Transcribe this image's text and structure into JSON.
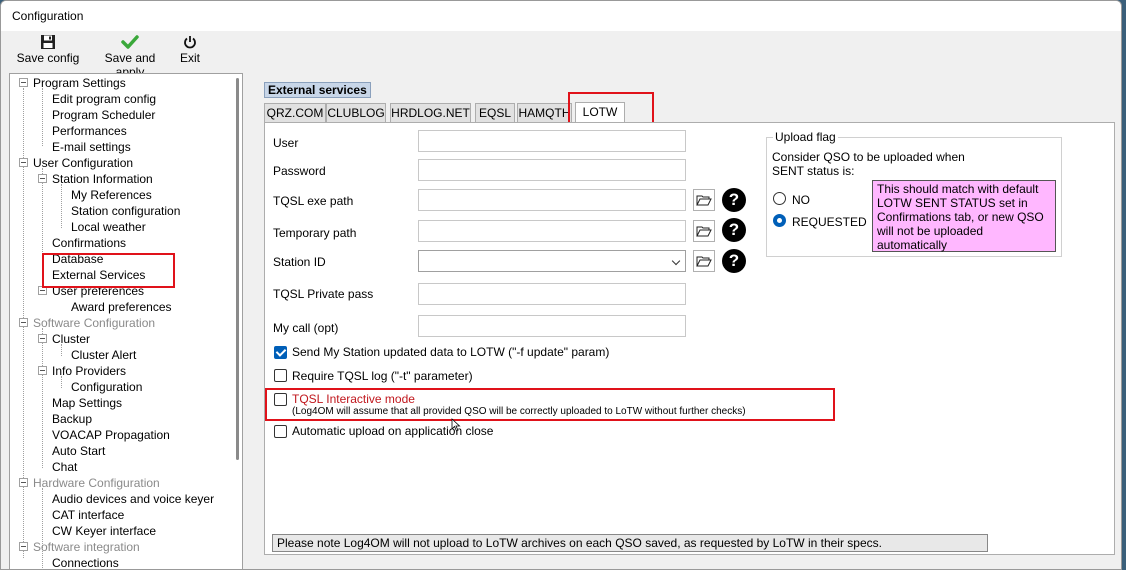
{
  "window": {
    "title": "Configuration"
  },
  "toolbar": {
    "save_config": "Save config",
    "save_apply": "Save and apply",
    "exit": "Exit"
  },
  "tree": {
    "program_settings": "Program Settings",
    "edit_program_config": "Edit program config",
    "program_scheduler": "Program Scheduler",
    "performances": "Performances",
    "email_settings": "E-mail settings",
    "user_configuration": "User Configuration",
    "station_information": "Station Information",
    "my_references": "My References",
    "station_configuration": "Station configuration",
    "local_weather": "Local weather",
    "confirmations": "Confirmations",
    "database": "Database",
    "external_services": "External Services",
    "user_preferences": "User preferences",
    "award_preferences": "Award preferences",
    "software_configuration": "Software Configuration",
    "cluster": "Cluster",
    "cluster_alert": "Cluster Alert",
    "info_providers": "Info Providers",
    "configuration": "Configuration",
    "map_settings": "Map Settings",
    "backup": "Backup",
    "voacap": "VOACAP Propagation",
    "auto_start": "Auto Start",
    "chat": "Chat",
    "hardware_configuration": "Hardware Configuration",
    "audio_devices": "Audio devices and voice keyer",
    "cat_interface": "CAT interface",
    "cw_keyer": "CW Keyer interface",
    "software_integration": "Software integration",
    "connections": "Connections"
  },
  "section_title": "External services",
  "tabs": [
    "QRZ.COM",
    "CLUBLOG",
    "HRDLOG.NET",
    "EQSL",
    "HAMQTH",
    "LOTW"
  ],
  "active_tab": "LOTW",
  "form": {
    "user_label": "User",
    "user_value": "",
    "password_label": "Password",
    "password_value": "",
    "tqsl_exe_label": "TQSL exe path",
    "tqsl_exe_value": "",
    "temp_path_label": "Temporary path",
    "temp_path_value": "",
    "station_id_label": "Station ID",
    "station_id_value": "",
    "tqsl_private_label": "TQSL Private pass",
    "tqsl_private_value": "",
    "my_call_label": "My call (opt)",
    "my_call_value": ""
  },
  "options": {
    "send_station": {
      "label": "Send My Station updated data to LOTW (\"-f update\" param)",
      "checked": true
    },
    "require_tqsl": {
      "label": "Require TQSL log (\"-t\" parameter)",
      "checked": false
    },
    "tqsl_interactive": {
      "label": "TQSL Interactive mode",
      "subtext": "(Log4OM will assume that all provided QSO will be correctly uploaded to LoTW without further checks)",
      "checked": false
    },
    "auto_upload": {
      "label": "Automatic upload on application close",
      "checked": false
    }
  },
  "upload_flag": {
    "legend": "Upload flag",
    "line1": "Consider QSO to be uploaded when",
    "line2": "SENT status is:",
    "no": "NO",
    "requested": "REQUESTED",
    "selected": "REQUESTED",
    "note": "This should match with default LOTW SENT STATUS set in Confirmations tab, or new QSO will not be uploaded automatically"
  },
  "footer_note": "Please note Log4OM will not upload to LoTW archives on each QSO saved, as requested by LoTW in their specs.",
  "colors": {
    "highlight_red": "#e0121a",
    "accent_blue": "#005fb8",
    "note_pink": "#ffb7ff",
    "interactive_text": "#c0171d"
  },
  "icons": {
    "save": "floppy-disk-icon",
    "save_apply": "green-check-icon",
    "exit": "power-icon",
    "folder": "folder-icon",
    "help": "question-icon"
  }
}
